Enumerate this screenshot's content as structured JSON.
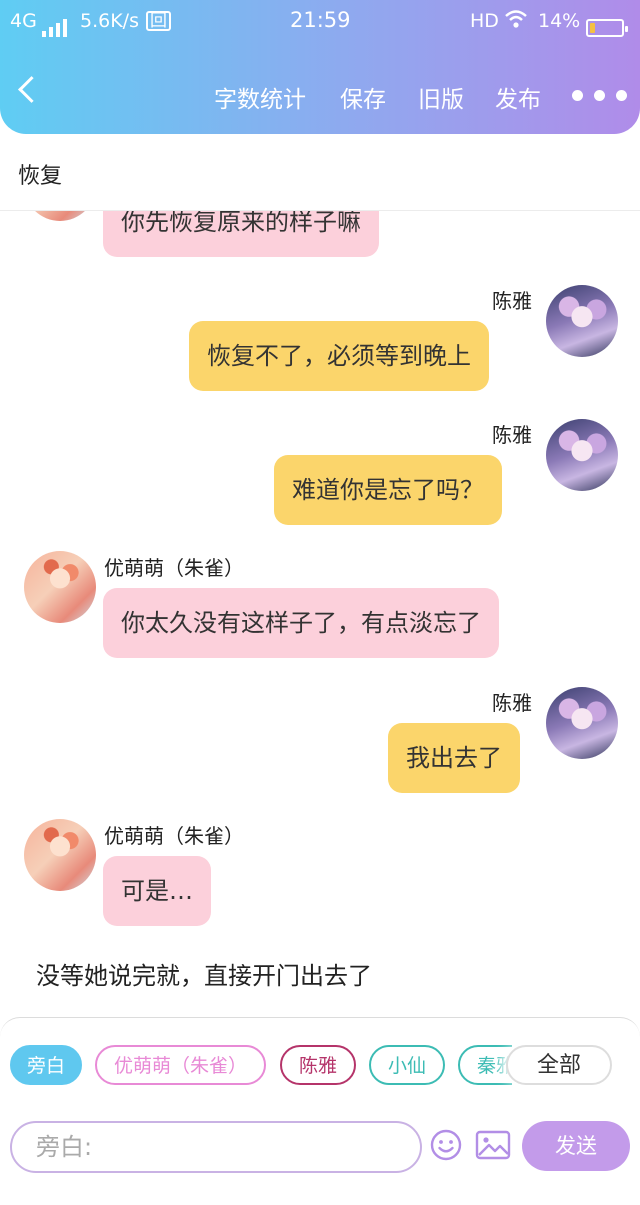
{
  "status_bar": {
    "network": "4G",
    "speed": "5.6K/s",
    "time": "21:59",
    "hd": "HD",
    "battery": "14%",
    "battery_level": 0.14
  },
  "toolbar": {
    "back_icon": "chevron-left-icon",
    "word_count": "字数统计",
    "save": "保存",
    "old_version": "旧版",
    "publish": "发布",
    "more_icon": "more-dots-icon"
  },
  "chapter_title": "恢复",
  "messages": [
    {
      "side": "left",
      "speaker": "",
      "text": "你先恢复原来的样子嘛",
      "color": "#fcd0db"
    },
    {
      "side": "right",
      "speaker": "陈雅",
      "text": "恢复不了，必须等到晚上",
      "color": "#fbd56b"
    },
    {
      "side": "right",
      "speaker": "陈雅",
      "text": "难道你是忘了吗？",
      "color": "#fbd56b"
    },
    {
      "side": "left",
      "speaker": "优萌萌（朱雀）",
      "text": "你太久没有这样子了，有点淡忘了",
      "color": "#fcd0db"
    },
    {
      "side": "right",
      "speaker": "陈雅",
      "text": "我出去了",
      "color": "#fbd56b"
    },
    {
      "side": "left",
      "speaker": "优萌萌（朱雀）",
      "text": "可是…",
      "color": "#fcd0db"
    }
  ],
  "narration": "没等她说完就，直接开门出去了",
  "role_tags": [
    {
      "label": "旁白",
      "color": "#5fc8ef",
      "selected": true
    },
    {
      "label": "优萌萌（朱雀）",
      "color": "#e88ad6",
      "selected": false
    },
    {
      "label": "陈雅",
      "color": "#b5346a",
      "selected": false
    },
    {
      "label": "小仙",
      "color": "#3cbcb4",
      "selected": false
    },
    {
      "label": "秦雅",
      "color": "#3cbcb4",
      "selected": false
    }
  ],
  "all_button": "全部",
  "input": {
    "placeholder": "旁白:"
  },
  "icons": {
    "emoji": "smiley-icon",
    "image": "image-icon"
  },
  "send_button": "发送"
}
